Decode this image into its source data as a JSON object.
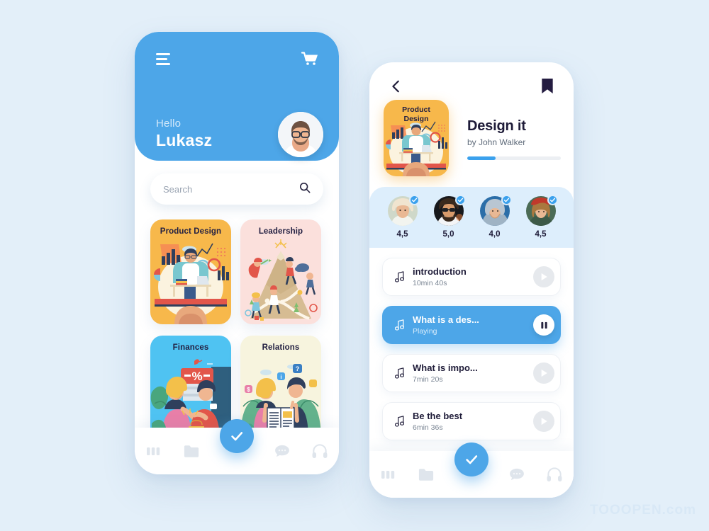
{
  "app": {
    "background_color": "#e3eff9",
    "accent_color": "#4da6e8",
    "dark_text_color": "#1e1b38"
  },
  "home_screen": {
    "menu_icon": "hamburger-icon",
    "cart_icon": "shopping-cart-icon",
    "greeting_small": "Hello",
    "greeting_name": "Lukasz",
    "avatar_icon": "user-avatar",
    "search": {
      "placeholder": "Search",
      "icon": "search-icon"
    },
    "categories": [
      {
        "title": "Product Design",
        "bg": "#f7b84b"
      },
      {
        "title": "Leadership",
        "bg": "#fbe0dc"
      },
      {
        "title": "Finances",
        "bg": "#4fc3f2"
      },
      {
        "title": "Relations",
        "bg": "#f7f4de"
      }
    ]
  },
  "detail_screen": {
    "back_icon": "chevron-left-icon",
    "bookmark_icon": "bookmark-icon",
    "course": {
      "thumb_title_line1": "Product",
      "thumb_title_line2": "Design",
      "title": "Design it",
      "author": "by John Walker",
      "progress_percent": 30
    },
    "raters": [
      {
        "score": "4,5",
        "verified": true
      },
      {
        "score": "5,0",
        "verified": true
      },
      {
        "score": "4,0",
        "verified": true
      },
      {
        "score": "4,5",
        "verified": true
      }
    ],
    "lessons": [
      {
        "title": "introduction",
        "subtitle": "10min 40s",
        "state": "paused",
        "action_icon": "play-icon"
      },
      {
        "title": "What is a des...",
        "subtitle": "Playing",
        "state": "playing",
        "action_icon": "pause-icon"
      },
      {
        "title": "What is impo...",
        "subtitle": "7min 20s",
        "state": "paused",
        "action_icon": "play-icon"
      },
      {
        "title": "Be the best",
        "subtitle": "6min 36s",
        "state": "paused",
        "action_icon": "play-icon"
      }
    ]
  },
  "bottom_nav": {
    "items": [
      {
        "icon": "dashboard-bars-icon"
      },
      {
        "icon": "folder-icon"
      },
      {
        "icon": "check-icon"
      },
      {
        "icon": "chat-bubble-icon"
      },
      {
        "icon": "headphones-icon"
      }
    ]
  },
  "watermark": {
    "text": "TOOOPEN.com"
  }
}
